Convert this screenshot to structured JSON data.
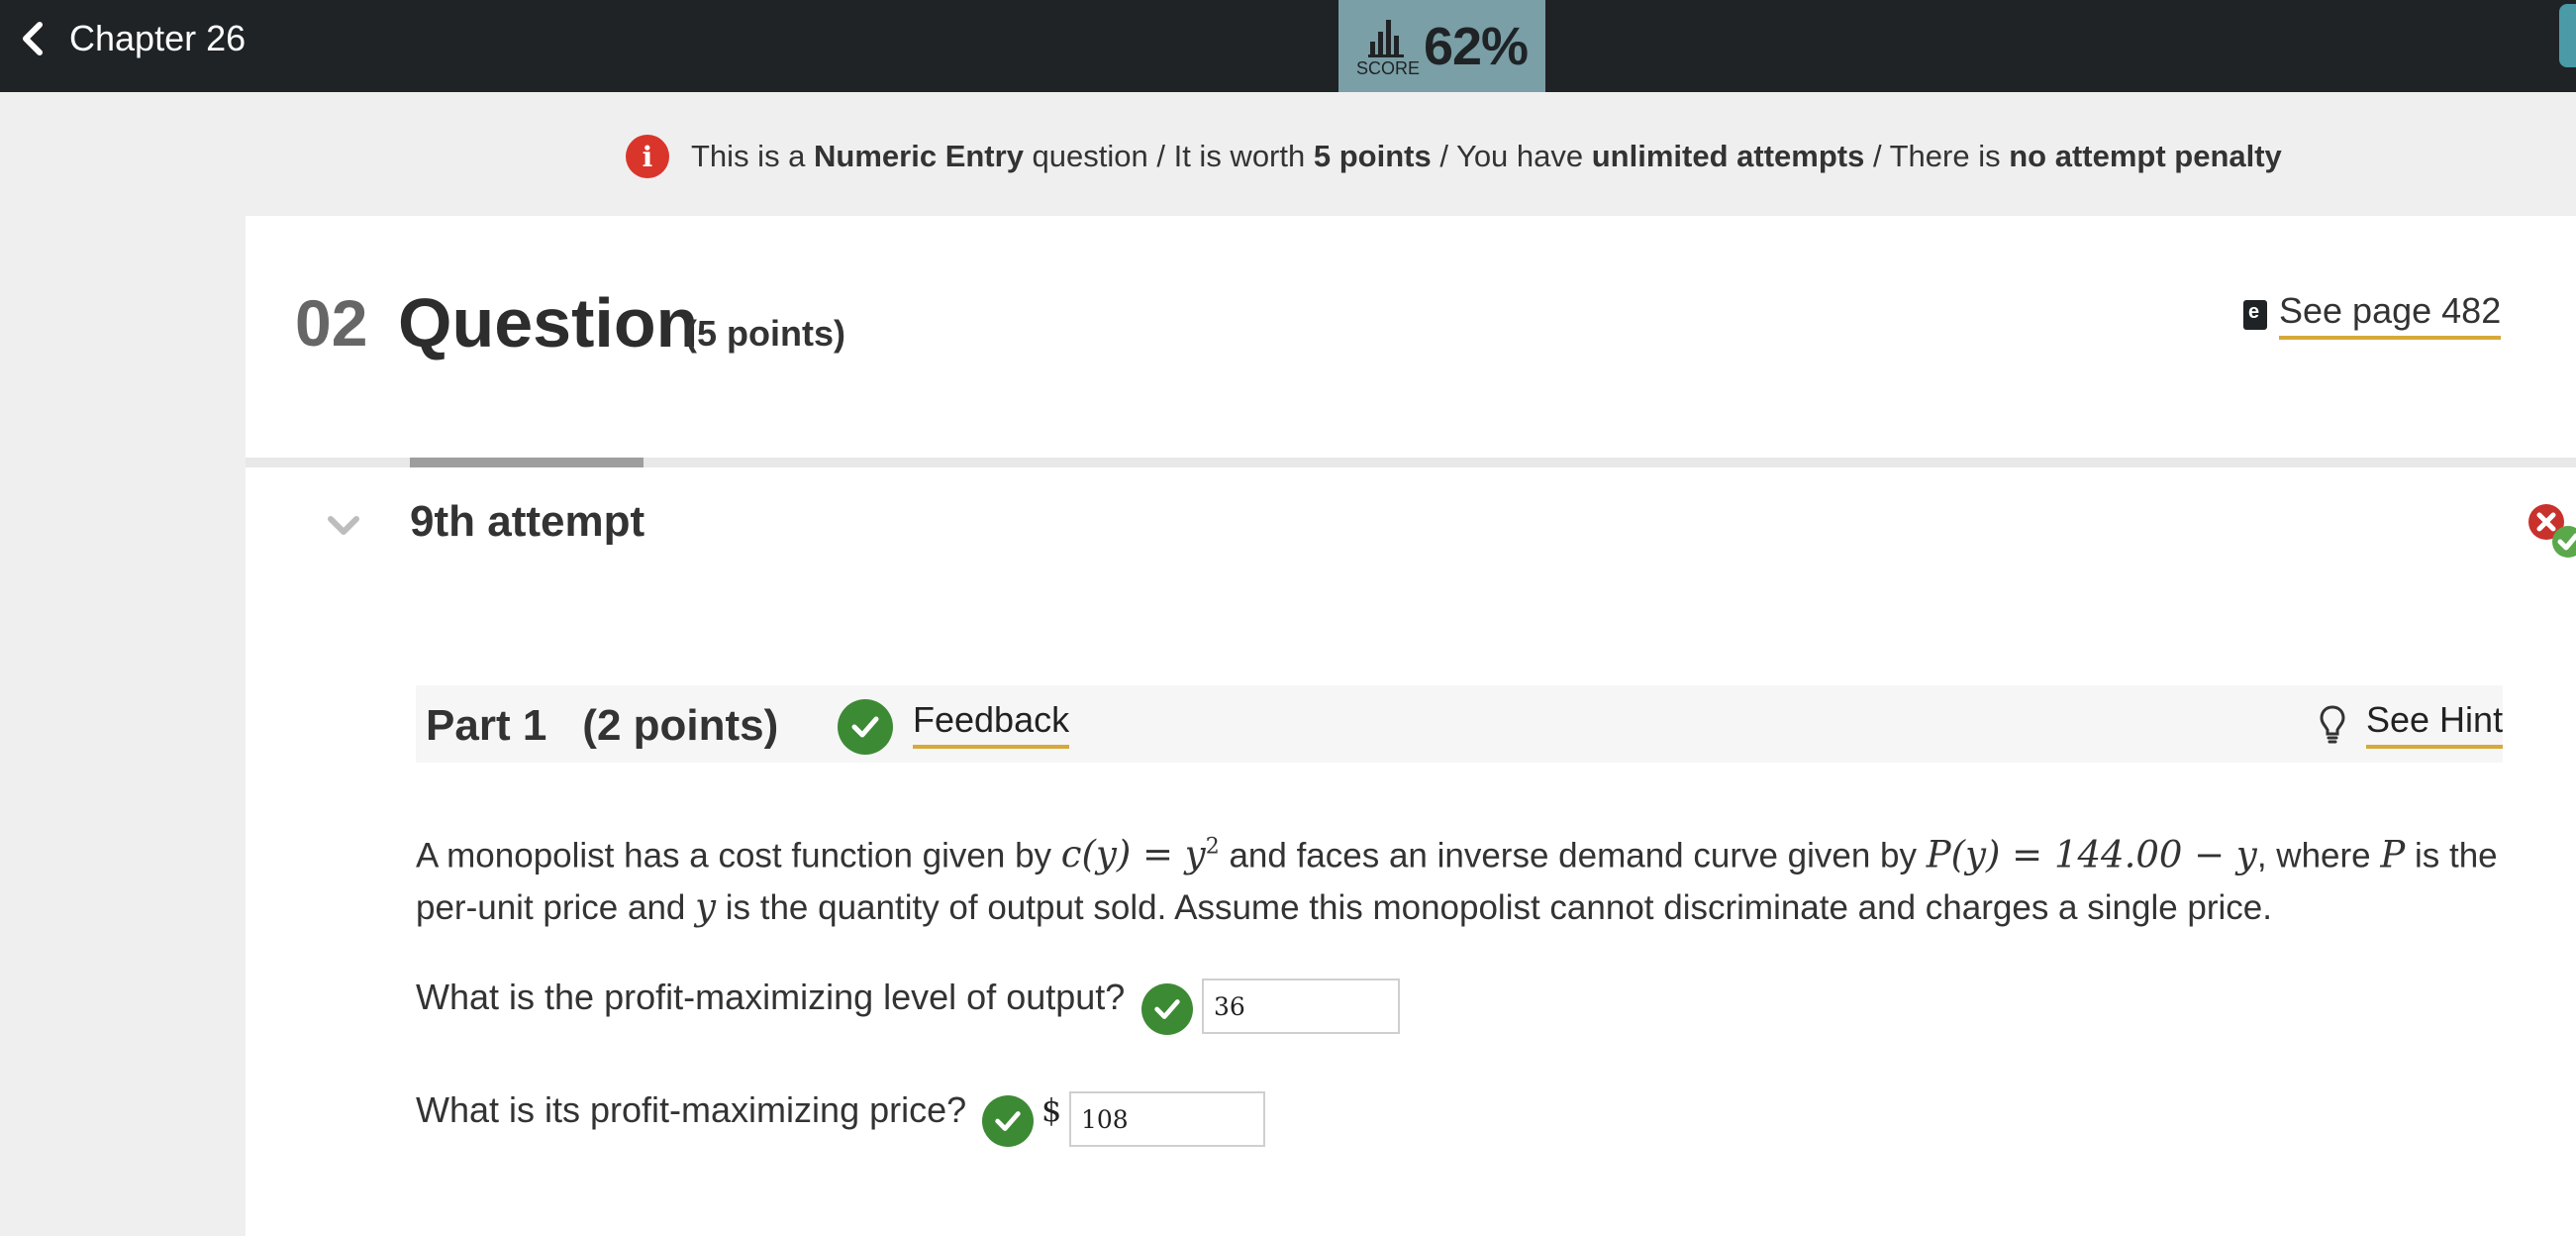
{
  "header": {
    "back_label": "Chapter 26",
    "score_label": "SCORE",
    "score_value": "62%"
  },
  "banner": {
    "p1": "This is a ",
    "type": "Numeric Entry",
    "p2": " question / It is worth ",
    "points": "5 points",
    "p3": " / You have ",
    "attempts": "unlimited attempts",
    "p4": " / There is ",
    "penalty": "no attempt penalty"
  },
  "question": {
    "number": "02",
    "title": "Question",
    "points": "(5 points)",
    "see_page": "See page 482"
  },
  "attempt": {
    "label": "9th attempt"
  },
  "part": {
    "title": "Part 1",
    "points": "(2 points)",
    "feedback": "Feedback",
    "hint": "See Hint"
  },
  "problem": {
    "t1": "A monopolist has a cost function given by ",
    "cost_fn": "c(y) = y",
    "cost_exp": "2",
    "t2": " and faces an inverse demand curve given by ",
    "demand_fn": "P(y) = 144.00 − y",
    "t3": ", where ",
    "var_p": "P",
    "t4": " is the per-unit price and ",
    "var_y": "y",
    "t5": " is the quantity of output sold. Assume this monopolist cannot discriminate and charges a single price."
  },
  "q1": {
    "text": "What is the profit-maximizing level of output?",
    "answer": "36"
  },
  "q2": {
    "text": "What is its profit-maximizing price?",
    "currency": "$",
    "answer": "108"
  }
}
